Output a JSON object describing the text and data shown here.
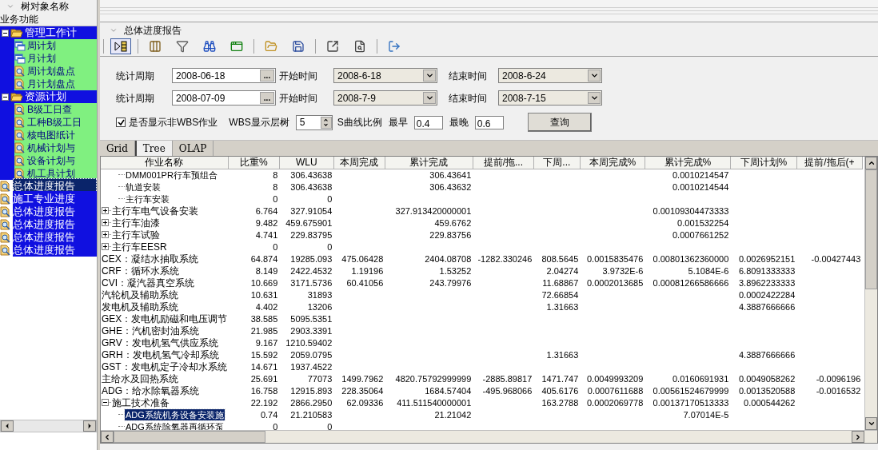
{
  "sidebar": {
    "header": "树对象名称",
    "section": "业务功能",
    "items": [
      {
        "label": "管理工作计",
        "kind": "group",
        "expanded": true,
        "selected": false,
        "children": [
          {
            "label": "周计划",
            "kind": "plan",
            "selected": false
          },
          {
            "label": "月计划",
            "kind": "plan",
            "selected": false
          },
          {
            "label": "周计划盘点",
            "kind": "query",
            "selected": false
          },
          {
            "label": "月计划盘点",
            "kind": "query",
            "selected": false
          }
        ]
      },
      {
        "label": "资源计划",
        "kind": "group",
        "expanded": true,
        "selected": false,
        "children": [
          {
            "label": "B级工日查",
            "kind": "query",
            "selected": false
          },
          {
            "label": "工种B级工日",
            "kind": "query",
            "selected": false
          },
          {
            "label": "核电图纸计",
            "kind": "query",
            "selected": false
          },
          {
            "label": "机械计划与",
            "kind": "query",
            "selected": false
          },
          {
            "label": "设备计划与",
            "kind": "query",
            "selected": false
          },
          {
            "label": "机工具计划",
            "kind": "query",
            "selected": false
          }
        ]
      },
      {
        "label": "总体进度报告",
        "kind": "query",
        "selected": true
      },
      {
        "label": "施工专业进度",
        "kind": "query",
        "selected": false
      },
      {
        "label": "总体进度报告",
        "kind": "query",
        "selected": false
      },
      {
        "label": "总体进度报告",
        "kind": "query",
        "selected": false
      },
      {
        "label": "总体进度报告",
        "kind": "query",
        "selected": false
      },
      {
        "label": "总体进度报告",
        "kind": "query",
        "selected": false
      }
    ]
  },
  "report": {
    "title": "总体进度报告",
    "toolbar": [
      {
        "pressed": true
      },
      {
        "pressed": false
      },
      {
        "pressed": false
      },
      {
        "pressed": false
      },
      {
        "pressed": false
      },
      {
        "pressed": false
      },
      {
        "pressed": false
      },
      {
        "pressed": false
      },
      {
        "pressed": false
      },
      {
        "pressed": false
      }
    ],
    "filters": {
      "periods": [
        {
          "label": "统计周期",
          "value": "2008-06-18",
          "browse": "...",
          "start_label": "开始时间",
          "start": "2008-6-18",
          "end_label": "结束时间",
          "end": "2008-6-24"
        },
        {
          "label": "统计周期",
          "value": "2008-07-09",
          "browse": "...",
          "start_label": "开始时间",
          "start": "2008-7-9",
          "end_label": "结束时间",
          "end": "2008-7-15"
        }
      ],
      "show_non_wbs": {
        "label": "是否显示非WBS作业",
        "checked": true
      },
      "wbs_depth": {
        "label": "WBS显示层树",
        "value": "5"
      },
      "s_curve": {
        "label": "S曲线比例",
        "earliest_label": "最早",
        "earliest": "0.4",
        "latest_label": "最晚",
        "latest": "0.6"
      },
      "query_button": "查询"
    },
    "tabs": [
      {
        "label": "Grid",
        "selected": false
      },
      {
        "label": "Tree",
        "selected": true
      },
      {
        "label": "OLAP",
        "selected": false
      }
    ],
    "table": {
      "columns": [
        "作业名称",
        "比重%",
        "WLU",
        "本周完成",
        "累计完成",
        "提前/拖...",
        "下周...",
        "本周完成%",
        "累计完成%",
        "下周计划%",
        "提前/拖后(+"
      ],
      "rows": [
        {
          "children": [
            {
              "name": "DMM001PR行车预组合",
              "selected": false,
              "values": {
                "weight": "8",
                "wlu": "306.43638",
                "total_done": "306.43641",
                "total_done_pct": "0.0010214547"
              }
            },
            {
              "name": "轨道安装",
              "selected": false,
              "values": {
                "weight": "8",
                "wlu": "306.43638",
                "total_done": "306.43632",
                "total_done_pct": "0.0010214544"
              }
            },
            {
              "name": "主行车安装",
              "selected": false,
              "values": {
                "weight": "0",
                "wlu": "0"
              }
            }
          ]
        },
        {
          "name": "主行车电气设备安装",
          "expanded": false,
          "selected": false,
          "values": {
            "weight": "6.764",
            "wlu": "327.91054",
            "total_done": "327.913420000001",
            "total_done_pct": "0.00109304473333"
          }
        },
        {
          "name": "主行车油漆",
          "expanded": false,
          "selected": false,
          "values": {
            "weight": "9.482",
            "wlu": "459.675901",
            "total_done": "459.6762",
            "total_done_pct": "0.001532254"
          }
        },
        {
          "name": "主行车试验",
          "expanded": false,
          "selected": false,
          "values": {
            "weight": "4.741",
            "wlu": "229.83795",
            "total_done": "229.83756",
            "total_done_pct": "0.0007661252"
          }
        },
        {
          "name": "主行车EESR",
          "expanded": false,
          "selected": false,
          "values": {
            "weight": "0",
            "wlu": "0"
          }
        },
        {
          "name": "CEX：凝结水抽取系统",
          "selected": false,
          "values": {
            "weight": "64.874",
            "wlu": "19285.093",
            "week_done": "475.06428",
            "total_done": "2404.08708",
            "ahead_lag": "-1282.330246",
            "next_week": "808.5645",
            "week_done_pct": "0.0015835476",
            "total_done_pct": "0.00801362360000",
            "next_week_pct": "0.0026952151",
            "ahead_lag_pct": "-0.00427443"
          }
        },
        {
          "name": "CRF：循环水系统",
          "selected": false,
          "values": {
            "weight": "8.149",
            "wlu": "2422.4532",
            "week_done": "1.19196",
            "total_done": "1.53252",
            "next_week": "2.04274",
            "week_done_pct": "3.9732E-6",
            "total_done_pct": "5.1084E-6",
            "next_week_pct": "6.8091333333"
          }
        },
        {
          "name": "CVI：凝汽器真空系统",
          "selected": false,
          "values": {
            "weight": "10.669",
            "wlu": "3171.5736",
            "week_done": "60.41056",
            "total_done": "243.79976",
            "next_week": "11.68867",
            "week_done_pct": "0.0002013685",
            "total_done_pct": "0.00081266586666",
            "next_week_pct": "3.8962233333"
          }
        },
        {
          "name": "汽轮机及辅助系统",
          "selected": false,
          "values": {
            "weight": "10.631",
            "wlu": "31893",
            "next_week": "72.66854",
            "next_week_pct": "0.0002422284"
          }
        },
        {
          "name": "发电机及辅助系统",
          "selected": false,
          "values": {
            "weight": "4.402",
            "wlu": "13206",
            "next_week": "1.31663",
            "next_week_pct": "4.3887666666"
          }
        },
        {
          "name": "GEX：发电机励磁和电压调节",
          "selected": false,
          "values": {
            "weight": "38.585",
            "wlu": "5095.5351"
          }
        },
        {
          "name": "GHE：汽机密封油系统",
          "selected": false,
          "values": {
            "weight": "21.985",
            "wlu": "2903.3391"
          }
        },
        {
          "name": "GRV：发电机氢气供应系统",
          "selected": false,
          "values": {
            "weight": "9.167",
            "wlu": "1210.59402"
          }
        },
        {
          "name": "GRH：发电机氢气冷却系统",
          "selected": false,
          "values": {
            "weight": "15.592",
            "wlu": "2059.0795",
            "next_week": "1.31663",
            "next_week_pct": "4.3887666666"
          }
        },
        {
          "name": "GST：发电机定子冷却水系统",
          "selected": false,
          "values": {
            "weight": "14.671",
            "wlu": "1937.4522"
          }
        },
        {
          "name": "主给水及回热系统",
          "selected": false,
          "values": {
            "weight": "25.691",
            "wlu": "77073",
            "week_done": "1499.7962",
            "total_done": "4820.75792999999",
            "ahead_lag": "-2885.89817",
            "next_week": "1471.747",
            "week_done_pct": "0.0049993209",
            "total_done_pct": "0.0160691931",
            "next_week_pct": "0.0049058262",
            "ahead_lag_pct": "-0.0096196"
          }
        },
        {
          "name": "ADG：给水除氧器系统",
          "selected": false,
          "values": {
            "weight": "16.758",
            "wlu": "12915.893",
            "week_done": "228.35064",
            "total_done": "1684.57404",
            "ahead_lag": "-495.968066",
            "next_week": "405.6176",
            "week_done_pct": "0.0007611688",
            "total_done_pct": "0.00561524679999",
            "next_week_pct": "0.0013520588",
            "ahead_lag_pct": "-0.0016532"
          }
        },
        {
          "name": "施工技术准备",
          "expanded": true,
          "selected": false,
          "values": {
            "weight": "22.192",
            "wlu": "2866.2950",
            "week_done": "62.09336",
            "total_done": "411.511540000001",
            "next_week": "163.2788",
            "week_done_pct": "0.0002069778",
            "total_done_pct": "0.00137170513333",
            "next_week_pct": "0.000544262"
          },
          "children": [
            {
              "name": "ADG系统机务设备安装施",
              "selected": true,
              "values": {
                "weight": "0.74",
                "wlu": "21.210583",
                "total_done": "21.21042",
                "total_done_pct": "7.07014E-5"
              }
            },
            {
              "name": "ADG系统除氧器再循环泵",
              "selected": false,
              "values": {
                "weight": "0",
                "wlu": "0"
              }
            }
          ]
        }
      ]
    }
  }
}
